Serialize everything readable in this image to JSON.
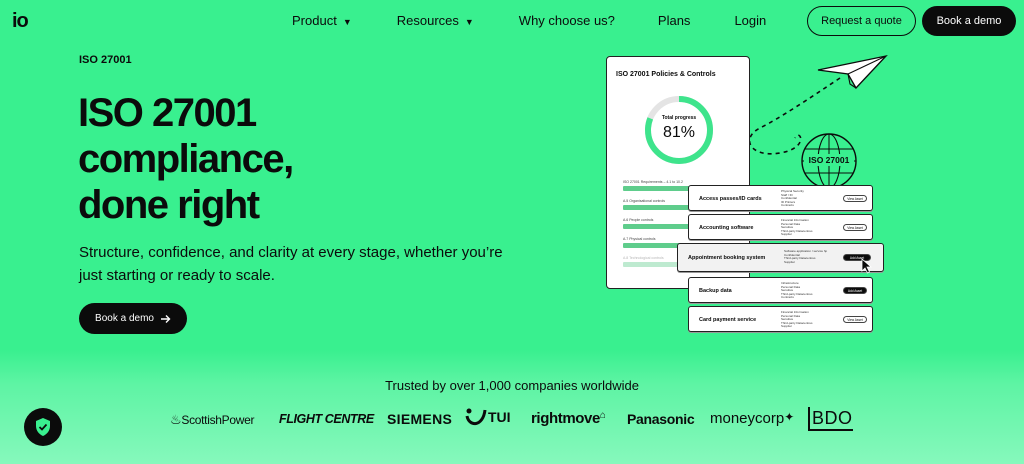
{
  "nav": {
    "logo": "io",
    "links": [
      {
        "label": "Product",
        "has_dropdown": true
      },
      {
        "label": "Resources",
        "has_dropdown": true
      },
      {
        "label": "Why choose us?",
        "has_dropdown": false
      },
      {
        "label": "Plans",
        "has_dropdown": false
      },
      {
        "label": "Login",
        "has_dropdown": false
      }
    ],
    "quote_button": "Request a quote",
    "demo_button": "Book a demo"
  },
  "hero": {
    "eyebrow": "ISO 27001",
    "title_line1": "ISO 27001",
    "title_line2": "compliance,",
    "title_line3": "done right",
    "subtitle": "Structure, confidence, and clarity at every stage, whether you’re just starting or ready to scale.",
    "cta": "Book a demo",
    "cta_icon": "arrow-right-icon"
  },
  "illustration": {
    "card_title": "ISO 27001 Policies & Controls",
    "progress_label": "Total progress",
    "progress_value": "81%",
    "progress_fraction": 0.81,
    "progress_rows": [
      {
        "label": "ISO 27001 Requirements – 4.1 to 10.2",
        "fraction": 1.0,
        "faded": false
      },
      {
        "label": "A.5 Organisational controls",
        "fraction": 1.0,
        "faded": false
      },
      {
        "label": "A.6 People controls",
        "fraction": 1.0,
        "faded": false
      },
      {
        "label": "A.7 Physical controls",
        "fraction": 1.0,
        "faded": false
      },
      {
        "label": "A.8 Technological controls",
        "fraction": 1.0,
        "faded": true
      }
    ],
    "globe_label": "ISO 27001",
    "services": [
      {
        "name": "Access passes/ID cards",
        "tags": [
          "Physical Security",
          "Staff / ID",
          "Confidential",
          "ID Printers",
          "Contracts"
        ],
        "button": "View Asset",
        "dark": false,
        "highlight": false
      },
      {
        "name": "Accounting software",
        "tags": [
          "Financial Information",
          "Personal Data",
          "Sensitive",
          "Third-party Datacentres",
          "Supplier"
        ],
        "button": "View Asset",
        "dark": false,
        "highlight": false
      },
      {
        "name": "Appointment booking system",
        "tags": [
          "Software application / service hp",
          "Confidential",
          "Third-party Datacentres",
          "Supplier"
        ],
        "button": "Add Asset",
        "dark": true,
        "highlight": true
      },
      {
        "name": "Backup data",
        "tags": [
          "Infrastructure",
          "Personal Data",
          "Sensitive",
          "Third-party Datacentres",
          "Contracts"
        ],
        "button": "Add Asset",
        "dark": true,
        "highlight": false
      },
      {
        "name": "Card payment service",
        "tags": [
          "Financial Information",
          "Personal Data",
          "Sensitive",
          "Third-party Datacentres",
          "Supplier"
        ],
        "button": "View Asset",
        "dark": false,
        "highlight": false
      }
    ]
  },
  "trusted": {
    "heading": "Trusted by over 1,000 companies worldwide",
    "logos": [
      "ScottishPower",
      "FLIGHT CENTRE",
      "SIEMENS",
      "TUI",
      "rightmove",
      "Panasonic",
      "moneycorp",
      "BDO"
    ]
  },
  "badge": {
    "icon": "shield-check-icon"
  },
  "colors": {
    "background": "#39f08f",
    "primary": "#0b0b0b",
    "accent": "#5fcd8c"
  }
}
